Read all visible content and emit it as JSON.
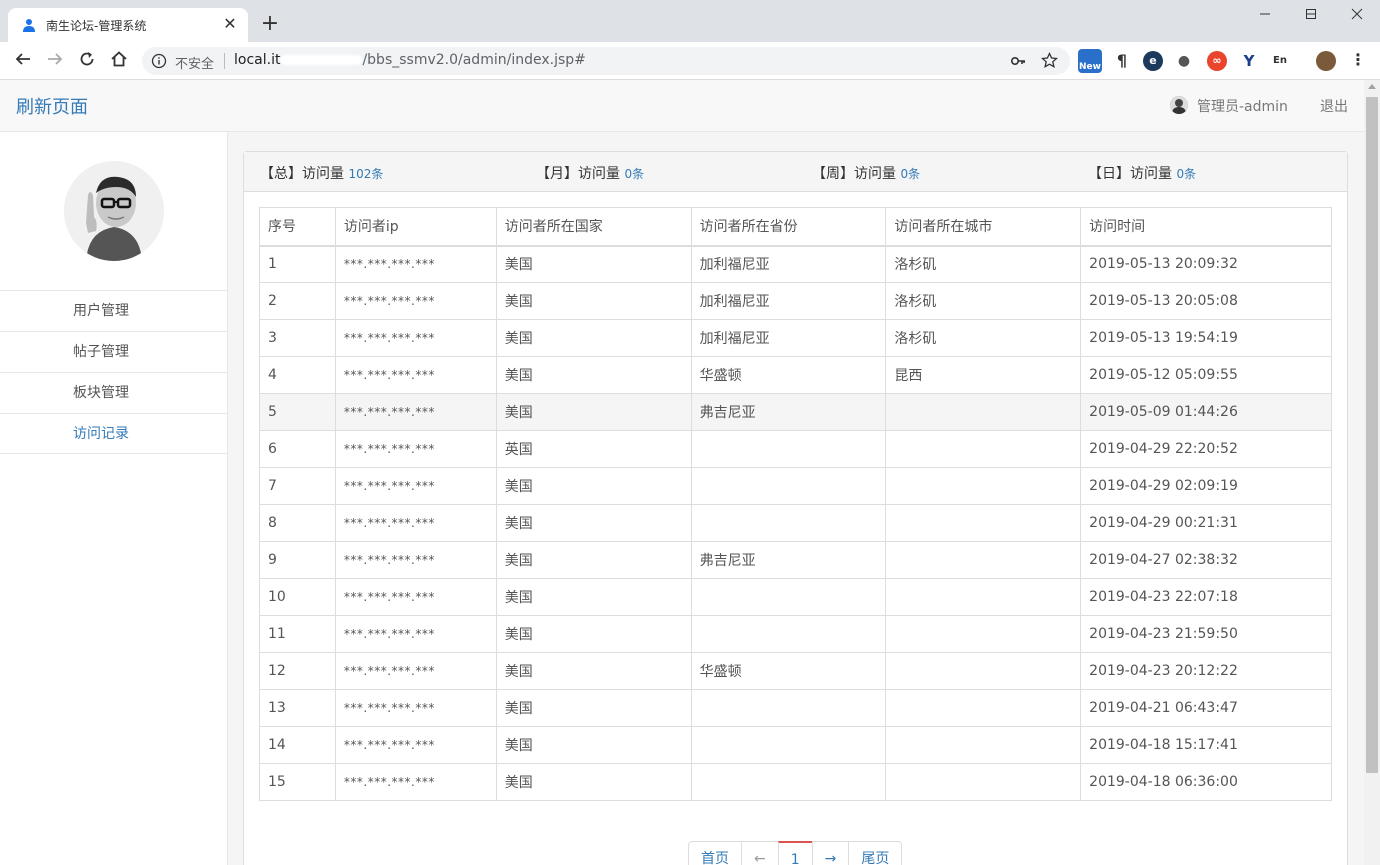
{
  "browser": {
    "tab_title": "南生论坛-管理系统",
    "security_label": "不安全",
    "url_host": "local.it",
    "url_path": "/bbs_ssmv2.0/admin/index.jsp#",
    "new_badge": "New"
  },
  "header": {
    "brand": "刷新页面",
    "user": "管理员-admin",
    "logout": "退出"
  },
  "sidebar": {
    "items": [
      {
        "label": "用户管理",
        "active": false
      },
      {
        "label": "帖子管理",
        "active": false
      },
      {
        "label": "板块管理",
        "active": false
      },
      {
        "label": "访问记录",
        "active": true
      }
    ]
  },
  "stats": {
    "total_label": "【总】访问量",
    "total_value": "102条",
    "month_label": "【月】访问量",
    "month_value": "0条",
    "week_label": "【周】访问量",
    "week_value": "0条",
    "day_label": "【日】访问量",
    "day_value": "0条"
  },
  "table": {
    "headers": [
      "序号",
      "访问者ip",
      "访问者所在国家",
      "访问者所在省份",
      "访问者所在城市",
      "访问时间"
    ],
    "rows": [
      [
        "1",
        "***.***.***.***",
        "美国",
        "加利福尼亚",
        "洛杉矶",
        "2019-05-13 20:09:32"
      ],
      [
        "2",
        "***.***.***.***",
        "美国",
        "加利福尼亚",
        "洛杉矶",
        "2019-05-13 20:05:08"
      ],
      [
        "3",
        "***.***.***.***",
        "美国",
        "加利福尼亚",
        "洛杉矶",
        "2019-05-13 19:54:19"
      ],
      [
        "4",
        "***.***.***.***",
        "美国",
        "华盛顿",
        "昆西",
        "2019-05-12 05:09:55"
      ],
      [
        "5",
        "***.***.***.***",
        "美国",
        "弗吉尼亚",
        "",
        "2019-05-09 01:44:26"
      ],
      [
        "6",
        "***.***.***.***",
        "英国",
        "",
        "",
        "2019-04-29 22:20:52"
      ],
      [
        "7",
        "***.***.***.***",
        "美国",
        "",
        "",
        "2019-04-29 02:09:19"
      ],
      [
        "8",
        "***.***.***.***",
        "美国",
        "",
        "",
        "2019-04-29 00:21:31"
      ],
      [
        "9",
        "***.***.***.***",
        "美国",
        "弗吉尼亚",
        "",
        "2019-04-27 02:38:32"
      ],
      [
        "10",
        "***.***.***.***",
        "美国",
        "",
        "",
        "2019-04-23 22:07:18"
      ],
      [
        "11",
        "***.***.***.***",
        "美国",
        "",
        "",
        "2019-04-23 21:59:50"
      ],
      [
        "12",
        "***.***.***.***",
        "美国",
        "华盛顿",
        "",
        "2019-04-23 20:12:22"
      ],
      [
        "13",
        "***.***.***.***",
        "美国",
        "",
        "",
        "2019-04-21 06:43:47"
      ],
      [
        "14",
        "***.***.***.***",
        "美国",
        "",
        "",
        "2019-04-18 15:17:41"
      ],
      [
        "15",
        "***.***.***.***",
        "美国",
        "",
        "",
        "2019-04-18 06:36:00"
      ]
    ],
    "highlighted_row": 5
  },
  "pager": {
    "first": "首页",
    "prev": "←",
    "current": "1",
    "next": "→",
    "last": "尾页"
  }
}
